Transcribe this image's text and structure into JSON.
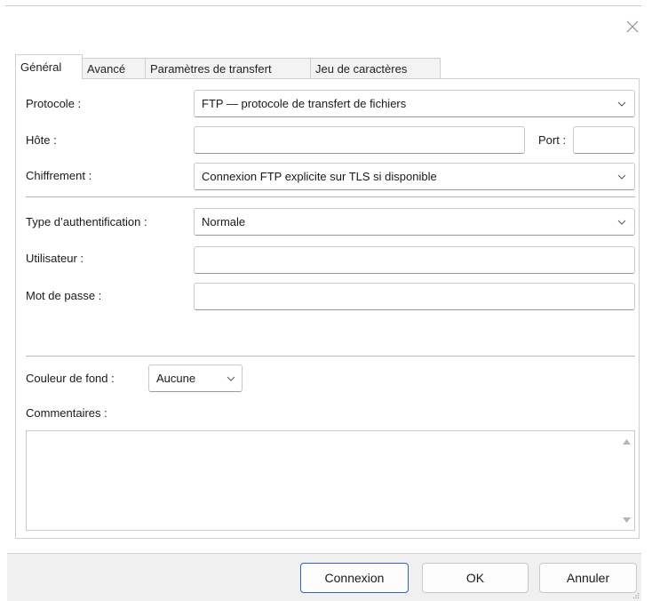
{
  "tabs": [
    {
      "label": "Général",
      "active": true
    },
    {
      "label": "Avancé"
    },
    {
      "label": "Paramètres de transfert"
    },
    {
      "label": "Jeu de caractères"
    }
  ],
  "general": {
    "protocol_label": "Protocole :",
    "protocol_value": "FTP — protocole de transfert de fichiers",
    "host_label": "Hôte :",
    "host_value": "",
    "port_label": "Port :",
    "port_value": "",
    "encryption_label": "Chiffrement :",
    "encryption_value": "Connexion FTP explicite sur TLS si disponible",
    "auth_type_label": "Type d’authentification :",
    "auth_type_value": "Normale",
    "user_label": "Utilisateur :",
    "user_value": "",
    "password_label": "Mot de passe :",
    "password_value": "",
    "bg_color_label": "Couleur de fond :",
    "bg_color_value": "Aucune",
    "comments_label": "Commentaires :",
    "comments_value": ""
  },
  "buttons": {
    "connect": "Connexion",
    "ok": "OK",
    "cancel": "Annuler"
  },
  "icons": {
    "close": "close-icon",
    "dropdown": "chevron-down-icon",
    "scroll_up": "scroll-up-arrow-icon",
    "scroll_down": "scroll-down-arrow-icon"
  },
  "colors": {
    "default_button_border": "#2f62b8",
    "footer_bg": "#f0f0f0"
  }
}
